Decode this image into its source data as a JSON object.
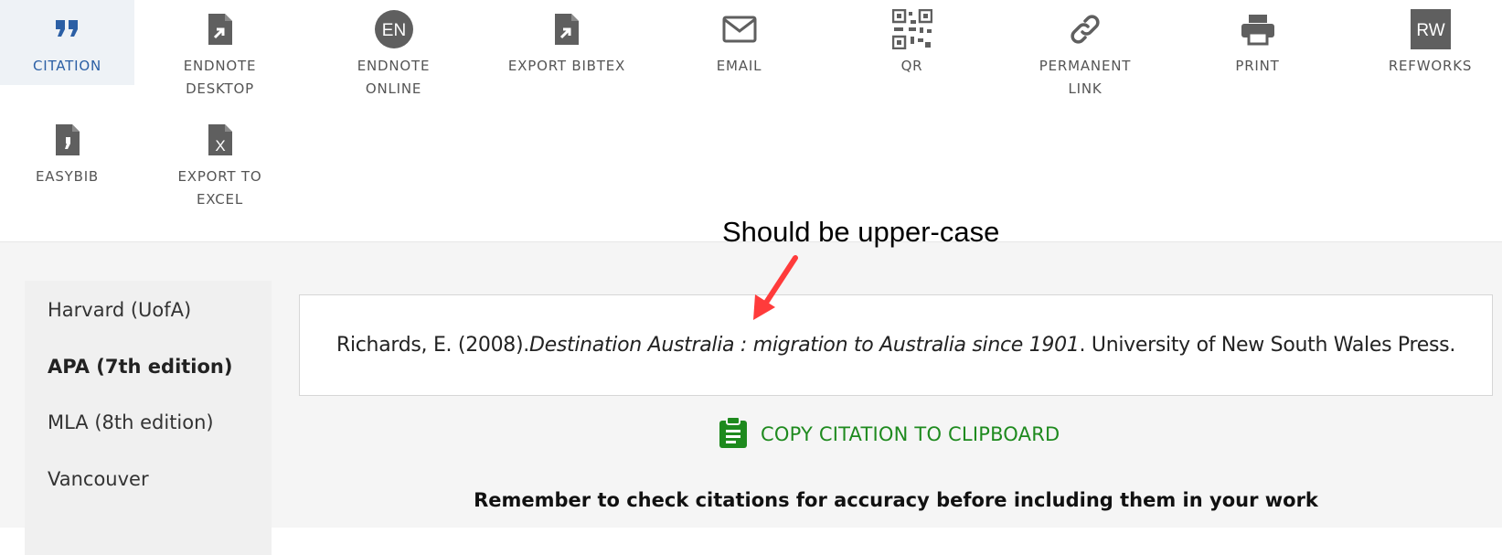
{
  "toolbar": {
    "tools": [
      {
        "label": "CITATION",
        "icon": "quote-icon"
      },
      {
        "label": "ENDNOTE\nDESKTOP",
        "icon": "endnote-desktop-icon"
      },
      {
        "label": "ENDNOTE\nONLINE",
        "icon": "endnote-online-icon",
        "badge": "EN"
      },
      {
        "label": "EXPORT BIBTEX",
        "icon": "export-bibtex-icon"
      },
      {
        "label": "EMAIL",
        "icon": "envelope-icon"
      },
      {
        "label": "QR",
        "icon": "qr-code-icon"
      },
      {
        "label": "PERMANENT\nLINK",
        "icon": "link-icon"
      },
      {
        "label": "PRINT",
        "icon": "printer-icon"
      },
      {
        "label": "REFWORKS",
        "icon": "refworks-icon",
        "badge": "RW"
      },
      {
        "label": "EASYBIB",
        "icon": "easybib-icon"
      },
      {
        "label": "EXPORT TO\nEXCEL",
        "icon": "excel-icon",
        "badge": "X"
      }
    ]
  },
  "styles": {
    "items": [
      "Harvard (UofA)",
      "APA (7th edition)",
      "MLA (8th edition)",
      "Vancouver"
    ],
    "active_index": 1
  },
  "citation": {
    "prefix": "Richards, E. (2008). ",
    "title": "Destination Australia : migration to Australia since 1901",
    "suffix": ". University of New South Wales Press."
  },
  "copy_button": {
    "label": "COPY CITATION TO CLIPBOARD",
    "icon": "clipboard-icon"
  },
  "reminder": "Remember to check citations for accuracy before including them in your work",
  "annotation": {
    "text": "Should be upper-case",
    "color": "#ff3b3b"
  },
  "colors": {
    "active_tab": "#2b5fa5",
    "copy_green": "#1e8a1e",
    "icon_gray": "#5f5f5f"
  }
}
